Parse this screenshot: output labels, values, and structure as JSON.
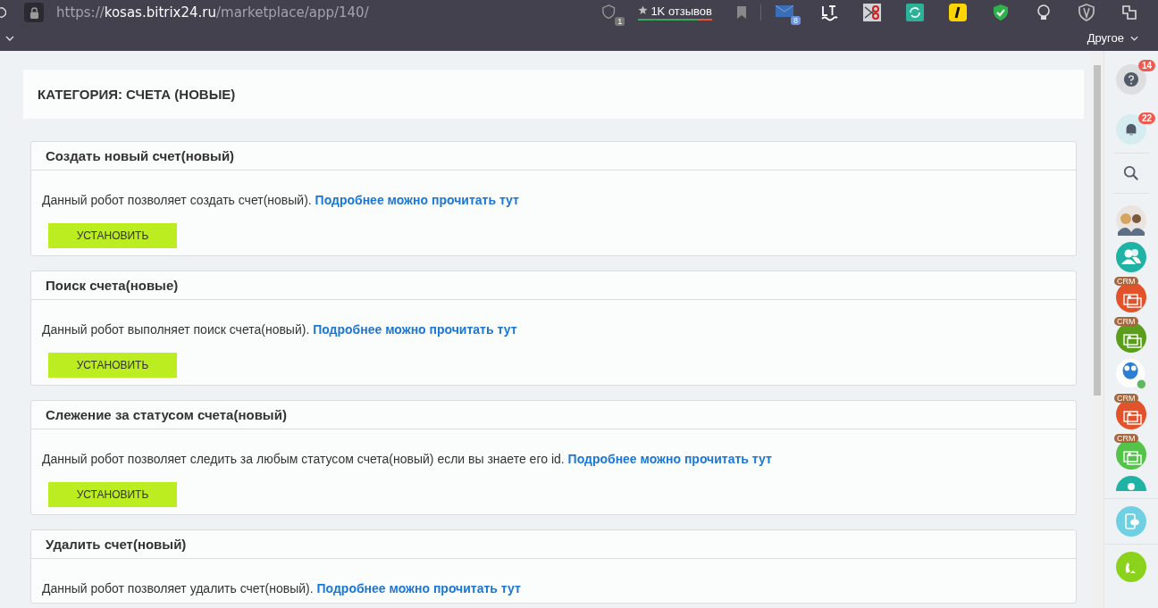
{
  "browser": {
    "url": {
      "scheme": "https://",
      "host": "kosas.bitrix24.ru",
      "path": "/marketplace/app/140/"
    },
    "shield_count": "1",
    "reviews": "1K отзывов",
    "mail_count": "8",
    "bookmarks_folder": "Другое"
  },
  "category": {
    "title": "КАТЕГОРИЯ: СЧЕТА (НОВЫЕ)"
  },
  "robots": [
    {
      "title": "Создать новый счет(новый)",
      "description": "Данный робот позволяет создать счет(новый).",
      "link": "Подробнее можно прочитать тут",
      "button": "УСТАНОВИТЬ"
    },
    {
      "title": "Поиск счета(новые)",
      "description": "Данный робот выполняет поиск счета(новый).",
      "link": "Подробнее можно прочитать тут",
      "button": "УСТАНОВИТЬ"
    },
    {
      "title": "Слежение за статусом счета(новый)",
      "description": "Данный робот позволяет следить за любым статусом счета(новый) если вы знаете его id.",
      "link": "Подробнее можно прочитать тут",
      "button": "УСТАНОВИТЬ"
    },
    {
      "title": "Удалить счет(новый)",
      "description": "Данный робот позволяет удалить счет(новый).",
      "link": "Подробнее можно прочитать тут"
    }
  ],
  "sidebar": {
    "help_count": "14",
    "notifications_count": "22",
    "items": [
      {
        "kind": "photo"
      },
      {
        "kind": "group",
        "color": "#1fb3a5"
      },
      {
        "kind": "crm",
        "label": "CRM",
        "color": "#e2522b"
      },
      {
        "kind": "crm",
        "label": "CRM",
        "color": "#5a9e1b"
      },
      {
        "kind": "bot"
      },
      {
        "kind": "crm",
        "label": "CRM",
        "color": "#e2522b"
      },
      {
        "kind": "crm",
        "label": "CRM",
        "color": "#55c24a"
      },
      {
        "kind": "user",
        "color": "#1fb3a5"
      }
    ]
  }
}
